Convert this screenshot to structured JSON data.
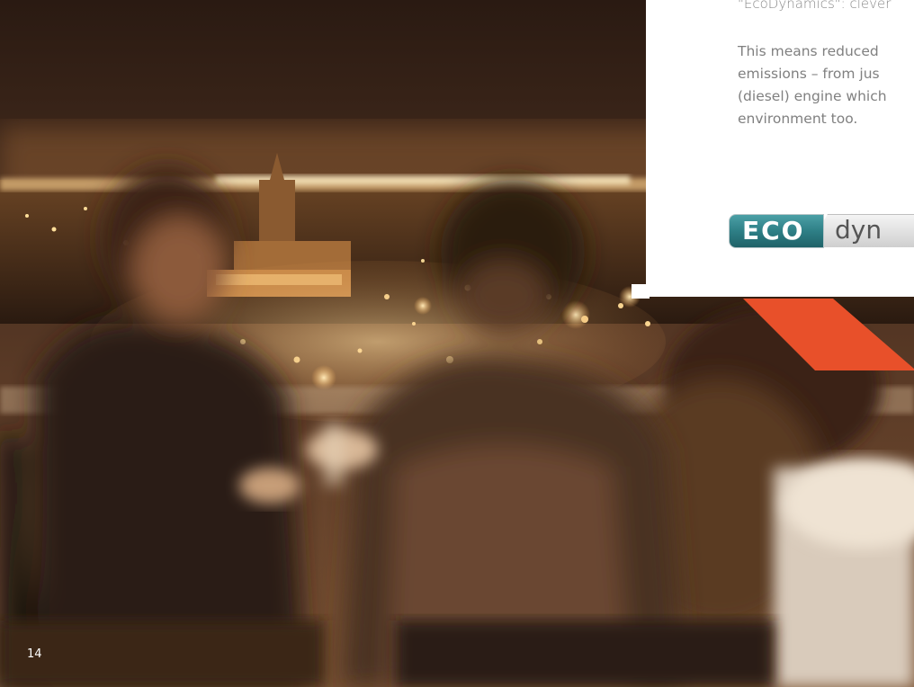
{
  "document": {
    "page_number": "14"
  },
  "text_panel": {
    "quote_line": "\"EcoDynamics\": clever",
    "body": "This means reduced\nemissions – from jus\n(diesel) engine which\nenvironment too."
  },
  "logo": {
    "eco_text": "ECO",
    "dynamics_text": "dyn",
    "colors": {
      "eco_teal": "#2e7f86",
      "dynamics_grey": "#d9d9d9"
    }
  },
  "accent": {
    "color": "#e8502a"
  },
  "photo": {
    "subject": "couple-on-rooftop-terrace-night-city-lights-icon"
  }
}
